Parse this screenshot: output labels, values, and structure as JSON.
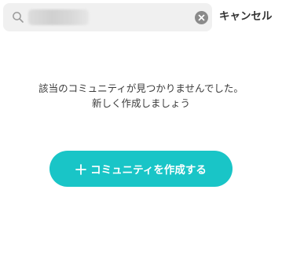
{
  "search": {
    "query": "",
    "clear_icon": "clear-circle-icon",
    "search_icon": "search-icon"
  },
  "header": {
    "cancel_label": "キャンセル"
  },
  "empty_state": {
    "line1": "該当のコミュニティが見つかりませんでした。",
    "line2": "新しく作成しましょう"
  },
  "actions": {
    "create_label": "コミュニティを作成する",
    "create_icon": "plus-icon"
  },
  "colors": {
    "accent": "#19c5c7",
    "search_background": "#f0f0f0",
    "text": "#333333"
  }
}
